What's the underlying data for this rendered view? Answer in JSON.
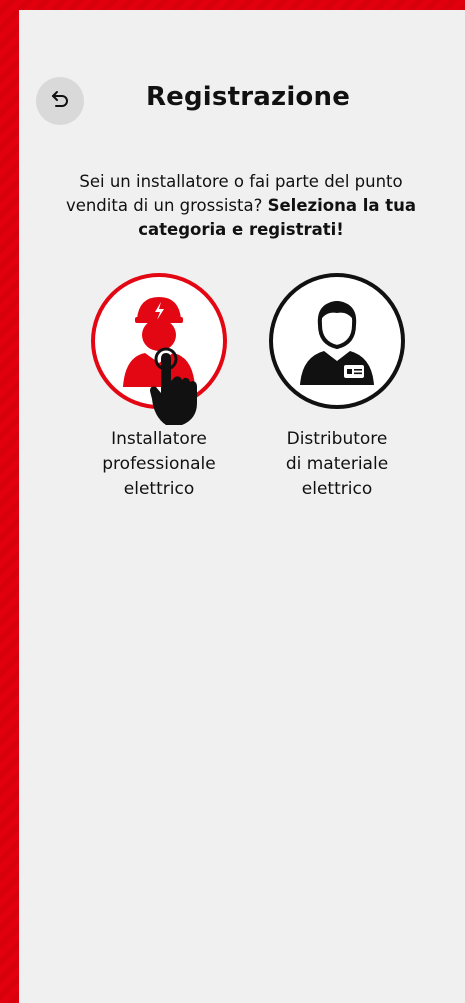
{
  "header": {
    "back_icon": "undo-arrow-icon",
    "title": "Registrazione"
  },
  "intro": {
    "text_plain": "Sei un installatore o fai parte del punto vendita di un grossista?",
    "text_bold": "Seleziona la tua categoria e registrati!"
  },
  "categories": [
    {
      "icon": "electrician-avatar-icon",
      "line1": "Installatore",
      "line2": "professionale",
      "line3": "elettrico",
      "accent": "#e30613"
    },
    {
      "icon": "distributor-avatar-icon",
      "line1": "Distributore",
      "line2": "di materiale",
      "line3": "elettrico",
      "accent": "#111111"
    }
  ],
  "colors": {
    "brand_red": "#e30613",
    "panel_bg": "#f0f0f0",
    "back_button_bg": "#d9d9d9"
  }
}
